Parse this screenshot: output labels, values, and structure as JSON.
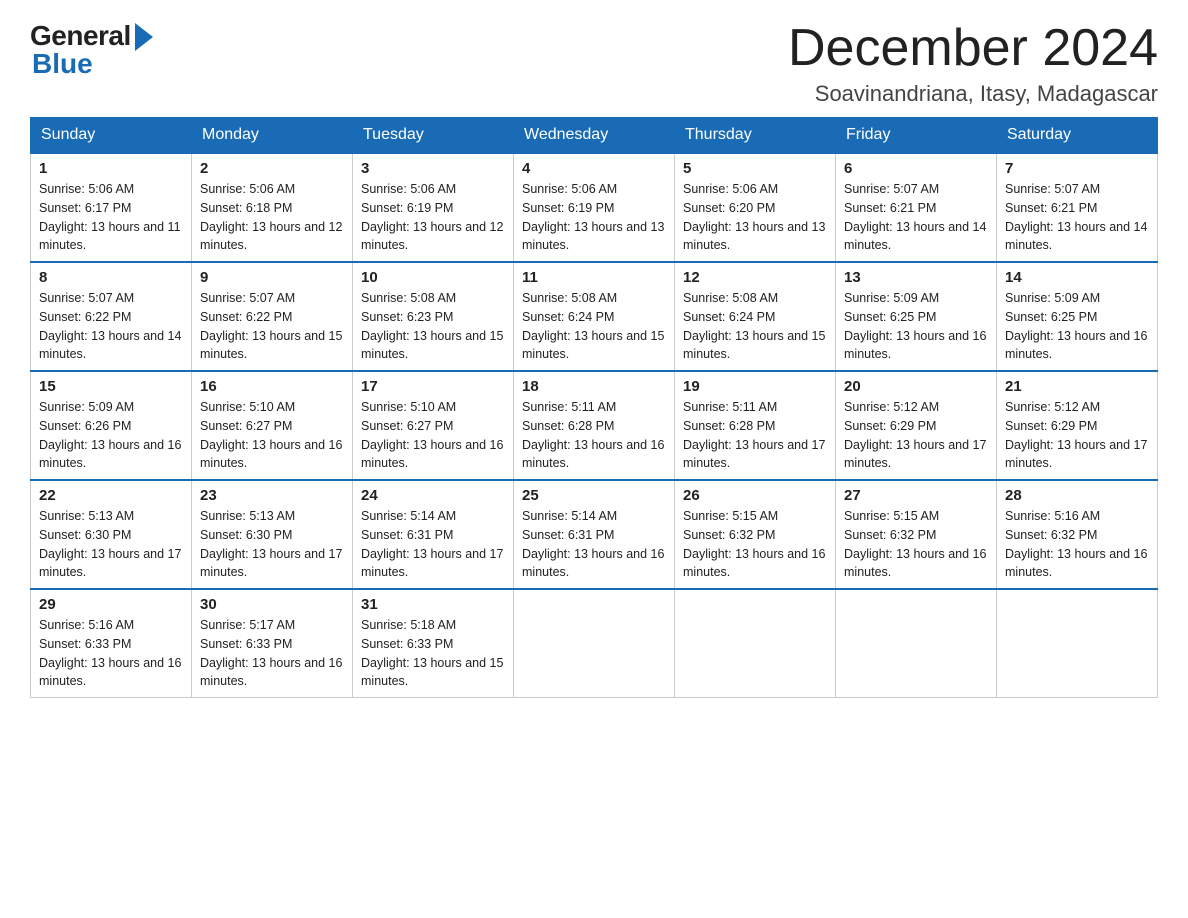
{
  "logo": {
    "general": "General",
    "blue": "Blue"
  },
  "header": {
    "month_year": "December 2024",
    "location": "Soavinandriana, Itasy, Madagascar"
  },
  "days_of_week": [
    "Sunday",
    "Monday",
    "Tuesday",
    "Wednesday",
    "Thursday",
    "Friday",
    "Saturday"
  ],
  "weeks": [
    [
      {
        "day": "1",
        "sunrise": "5:06 AM",
        "sunset": "6:17 PM",
        "daylight": "13 hours and 11 minutes."
      },
      {
        "day": "2",
        "sunrise": "5:06 AM",
        "sunset": "6:18 PM",
        "daylight": "13 hours and 12 minutes."
      },
      {
        "day": "3",
        "sunrise": "5:06 AM",
        "sunset": "6:19 PM",
        "daylight": "13 hours and 12 minutes."
      },
      {
        "day": "4",
        "sunrise": "5:06 AM",
        "sunset": "6:19 PM",
        "daylight": "13 hours and 13 minutes."
      },
      {
        "day": "5",
        "sunrise": "5:06 AM",
        "sunset": "6:20 PM",
        "daylight": "13 hours and 13 minutes."
      },
      {
        "day": "6",
        "sunrise": "5:07 AM",
        "sunset": "6:21 PM",
        "daylight": "13 hours and 14 minutes."
      },
      {
        "day": "7",
        "sunrise": "5:07 AM",
        "sunset": "6:21 PM",
        "daylight": "13 hours and 14 minutes."
      }
    ],
    [
      {
        "day": "8",
        "sunrise": "5:07 AM",
        "sunset": "6:22 PM",
        "daylight": "13 hours and 14 minutes."
      },
      {
        "day": "9",
        "sunrise": "5:07 AM",
        "sunset": "6:22 PM",
        "daylight": "13 hours and 15 minutes."
      },
      {
        "day": "10",
        "sunrise": "5:08 AM",
        "sunset": "6:23 PM",
        "daylight": "13 hours and 15 minutes."
      },
      {
        "day": "11",
        "sunrise": "5:08 AM",
        "sunset": "6:24 PM",
        "daylight": "13 hours and 15 minutes."
      },
      {
        "day": "12",
        "sunrise": "5:08 AM",
        "sunset": "6:24 PM",
        "daylight": "13 hours and 15 minutes."
      },
      {
        "day": "13",
        "sunrise": "5:09 AM",
        "sunset": "6:25 PM",
        "daylight": "13 hours and 16 minutes."
      },
      {
        "day": "14",
        "sunrise": "5:09 AM",
        "sunset": "6:25 PM",
        "daylight": "13 hours and 16 minutes."
      }
    ],
    [
      {
        "day": "15",
        "sunrise": "5:09 AM",
        "sunset": "6:26 PM",
        "daylight": "13 hours and 16 minutes."
      },
      {
        "day": "16",
        "sunrise": "5:10 AM",
        "sunset": "6:27 PM",
        "daylight": "13 hours and 16 minutes."
      },
      {
        "day": "17",
        "sunrise": "5:10 AM",
        "sunset": "6:27 PM",
        "daylight": "13 hours and 16 minutes."
      },
      {
        "day": "18",
        "sunrise": "5:11 AM",
        "sunset": "6:28 PM",
        "daylight": "13 hours and 16 minutes."
      },
      {
        "day": "19",
        "sunrise": "5:11 AM",
        "sunset": "6:28 PM",
        "daylight": "13 hours and 17 minutes."
      },
      {
        "day": "20",
        "sunrise": "5:12 AM",
        "sunset": "6:29 PM",
        "daylight": "13 hours and 17 minutes."
      },
      {
        "day": "21",
        "sunrise": "5:12 AM",
        "sunset": "6:29 PM",
        "daylight": "13 hours and 17 minutes."
      }
    ],
    [
      {
        "day": "22",
        "sunrise": "5:13 AM",
        "sunset": "6:30 PM",
        "daylight": "13 hours and 17 minutes."
      },
      {
        "day": "23",
        "sunrise": "5:13 AM",
        "sunset": "6:30 PM",
        "daylight": "13 hours and 17 minutes."
      },
      {
        "day": "24",
        "sunrise": "5:14 AM",
        "sunset": "6:31 PM",
        "daylight": "13 hours and 17 minutes."
      },
      {
        "day": "25",
        "sunrise": "5:14 AM",
        "sunset": "6:31 PM",
        "daylight": "13 hours and 16 minutes."
      },
      {
        "day": "26",
        "sunrise": "5:15 AM",
        "sunset": "6:32 PM",
        "daylight": "13 hours and 16 minutes."
      },
      {
        "day": "27",
        "sunrise": "5:15 AM",
        "sunset": "6:32 PM",
        "daylight": "13 hours and 16 minutes."
      },
      {
        "day": "28",
        "sunrise": "5:16 AM",
        "sunset": "6:32 PM",
        "daylight": "13 hours and 16 minutes."
      }
    ],
    [
      {
        "day": "29",
        "sunrise": "5:16 AM",
        "sunset": "6:33 PM",
        "daylight": "13 hours and 16 minutes."
      },
      {
        "day": "30",
        "sunrise": "5:17 AM",
        "sunset": "6:33 PM",
        "daylight": "13 hours and 16 minutes."
      },
      {
        "day": "31",
        "sunrise": "5:18 AM",
        "sunset": "6:33 PM",
        "daylight": "13 hours and 15 minutes."
      },
      null,
      null,
      null,
      null
    ]
  ],
  "labels": {
    "sunrise_prefix": "Sunrise: ",
    "sunset_prefix": "Sunset: ",
    "daylight_prefix": "Daylight: "
  }
}
